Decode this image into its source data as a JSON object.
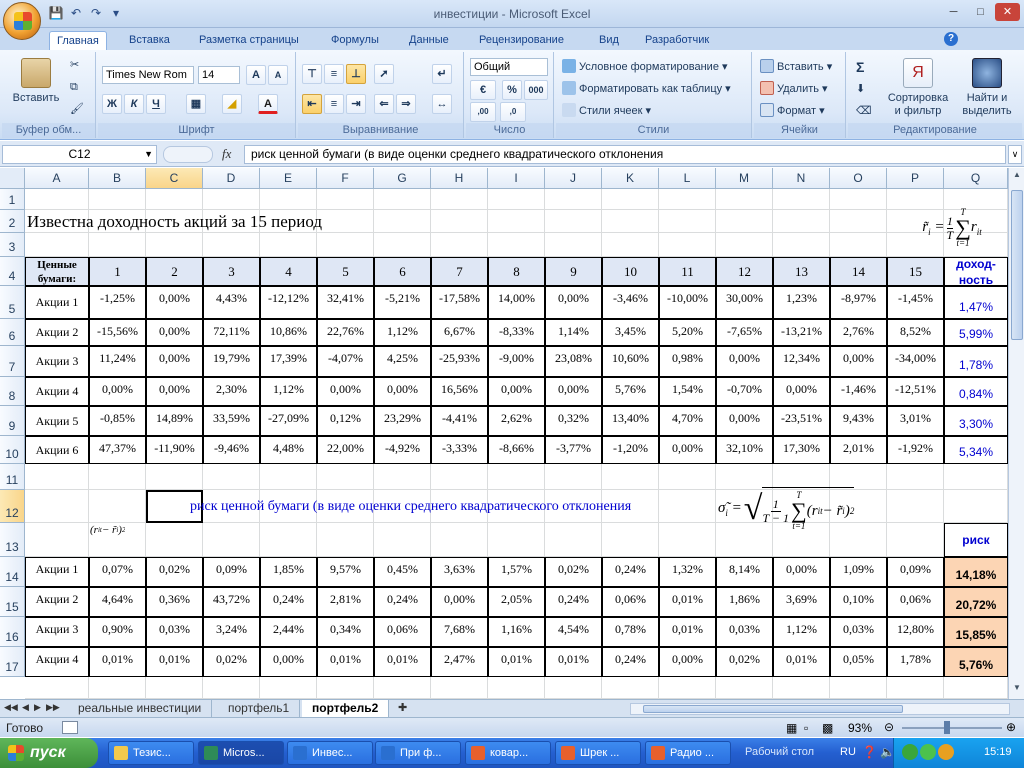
{
  "window": {
    "title": "инвестиции - Microsoft Excel"
  },
  "tabs": [
    "Главная",
    "Вставка",
    "Разметка страницы",
    "Формулы",
    "Данные",
    "Рецензирование",
    "Вид",
    "Разработчик"
  ],
  "ribbon": {
    "clipboard": {
      "paste": "Вставить",
      "label": "Буфер обм..."
    },
    "font": {
      "name": "Times New Rom",
      "size": "14",
      "bold": "Ж",
      "italic": "К",
      "underline": "Ч",
      "grow": "A",
      "shrink": "A",
      "color": "A",
      "label": "Шрифт"
    },
    "alignment": {
      "label": "Выравнивание"
    },
    "number": {
      "format": "Общий",
      "percent": "%",
      "thousands": "000",
      "label": "Число"
    },
    "styles": {
      "conditional": "Условное форматирование",
      "table": "Форматировать как таблицу",
      "cell_styles": "Стили ячеек",
      "label": "Стили"
    },
    "cells": {
      "insert": "Вставить",
      "delete": "Удалить",
      "format": "Формат",
      "label": "Ячейки"
    },
    "editing": {
      "sigma": "Σ",
      "sort1": "Сортировка",
      "sort2": "и фильтр",
      "find1": "Найти и",
      "find2": "выделить",
      "label": "Редактирование"
    }
  },
  "formula_bar": {
    "name_box": "C12",
    "fx": "fx",
    "formula": "риск ценной бумаги (в виде оценки среднего квадратического отклонения"
  },
  "grid": {
    "columns": [
      "A",
      "B",
      "C",
      "D",
      "E",
      "F",
      "G",
      "H",
      "I",
      "J",
      "K",
      "L",
      "M",
      "N",
      "O",
      "P",
      "Q"
    ],
    "rows": [
      "1",
      "2",
      "3",
      "4",
      "5",
      "6",
      "7",
      "8",
      "9",
      "10",
      "11",
      "12",
      "13",
      "14",
      "15",
      "16",
      "17"
    ],
    "title": "Известна доходность акций за 15 период",
    "header_label": "Ценные бумаги:",
    "periods": [
      "1",
      "2",
      "3",
      "4",
      "5",
      "6",
      "7",
      "8",
      "9",
      "10",
      "11",
      "12",
      "13",
      "14",
      "15"
    ],
    "income_header": "доход-ность",
    "returns": [
      {
        "name": "Акции 1",
        "values": [
          "-1,25%",
          "0,00%",
          "4,43%",
          "-12,12%",
          "32,41%",
          "-5,21%",
          "-17,58%",
          "14,00%",
          "0,00%",
          "-3,46%",
          "-10,00%",
          "30,00%",
          "1,23%",
          "-8,97%",
          "-1,45%"
        ],
        "income": "1,47%"
      },
      {
        "name": "Акции 2",
        "values": [
          "-15,56%",
          "0,00%",
          "72,11%",
          "10,86%",
          "22,76%",
          "1,12%",
          "6,67%",
          "-8,33%",
          "1,14%",
          "3,45%",
          "5,20%",
          "-7,65%",
          "-13,21%",
          "2,76%",
          "8,52%"
        ],
        "income": "5,99%"
      },
      {
        "name": "Акции 3",
        "values": [
          "11,24%",
          "0,00%",
          "19,79%",
          "17,39%",
          "-4,07%",
          "4,25%",
          "-25,93%",
          "-9,00%",
          "23,08%",
          "10,60%",
          "0,98%",
          "0,00%",
          "12,34%",
          "0,00%",
          "-34,00%"
        ],
        "income": "1,78%"
      },
      {
        "name": "Акции 4",
        "values": [
          "0,00%",
          "0,00%",
          "2,30%",
          "1,12%",
          "0,00%",
          "0,00%",
          "16,56%",
          "0,00%",
          "0,00%",
          "5,76%",
          "1,54%",
          "-0,70%",
          "0,00%",
          "-1,46%",
          "-12,51%"
        ],
        "income": "0,84%"
      },
      {
        "name": "Акции 5",
        "values": [
          "-0,85%",
          "14,89%",
          "33,59%",
          "-27,09%",
          "0,12%",
          "23,29%",
          "-4,41%",
          "2,62%",
          "0,32%",
          "13,40%",
          "4,70%",
          "0,00%",
          "-23,51%",
          "9,43%",
          "3,01%"
        ],
        "income": "3,30%"
      },
      {
        "name": "Акции 6",
        "values": [
          "47,37%",
          "-11,90%",
          "-9,46%",
          "4,48%",
          "22,00%",
          "-4,92%",
          "-3,33%",
          "-8,66%",
          "-3,77%",
          "-1,20%",
          "0,00%",
          "32,10%",
          "17,30%",
          "2,01%",
          "-1,92%"
        ],
        "income": "5,34%"
      }
    ],
    "risk_text": "риск ценной бумаги (в виде оценки среднего квадратического отклонения",
    "risk_header": "риск",
    "deviations": [
      {
        "name": "Акции 1",
        "values": [
          "0,07%",
          "0,02%",
          "0,09%",
          "1,85%",
          "9,57%",
          "0,45%",
          "3,63%",
          "1,57%",
          "0,02%",
          "0,24%",
          "1,32%",
          "8,14%",
          "0,00%",
          "1,09%",
          "0,09%"
        ],
        "risk": "14,18%"
      },
      {
        "name": "Акции 2",
        "values": [
          "4,64%",
          "0,36%",
          "43,72%",
          "0,24%",
          "2,81%",
          "0,24%",
          "0,00%",
          "2,05%",
          "0,24%",
          "0,06%",
          "0,01%",
          "1,86%",
          "3,69%",
          "0,10%",
          "0,06%"
        ],
        "risk": "20,72%"
      },
      {
        "name": "Акции 3",
        "values": [
          "0,90%",
          "0,03%",
          "3,24%",
          "2,44%",
          "0,34%",
          "0,06%",
          "7,68%",
          "1,16%",
          "4,54%",
          "0,78%",
          "0,01%",
          "0,03%",
          "1,12%",
          "0,03%",
          "12,80%"
        ],
        "risk": "15,85%"
      },
      {
        "name": "Акции 4",
        "values": [
          "0,01%",
          "0,01%",
          "0,02%",
          "0,00%",
          "0,01%",
          "0,01%",
          "2,47%",
          "0,01%",
          "0,01%",
          "0,24%",
          "0,00%",
          "0,02%",
          "0,01%",
          "0,05%",
          "1,78%"
        ],
        "risk": "5,76%"
      }
    ]
  },
  "sheets": [
    "реальные инвестиции",
    "портфель1",
    "портфель2"
  ],
  "status": {
    "ready": "Готово",
    "zoom": "93%"
  },
  "taskbar": {
    "start": "пуск",
    "buttons": [
      "Тезис...",
      "Micros...",
      "Инвес...",
      "При ф...",
      "ковар...",
      "Шрек ...",
      "Радио ..."
    ],
    "desktop": "Рабочий стол",
    "lang": "RU",
    "time": "15:19"
  }
}
